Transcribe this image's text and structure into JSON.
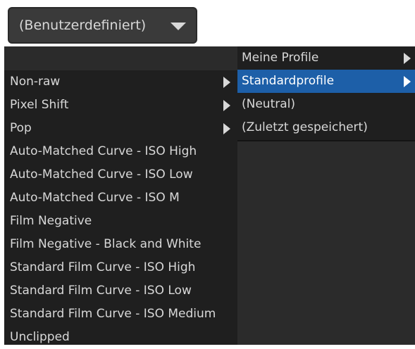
{
  "profile_combo": {
    "value": "(Benutzerdefiniert)"
  },
  "profile_menu": {
    "items": [
      {
        "label": "Meine Profile",
        "has_submenu": true,
        "selected": false
      },
      {
        "label": "Standardprofile",
        "has_submenu": true,
        "selected": true
      },
      {
        "label": "(Neutral)",
        "has_submenu": false,
        "selected": false
      },
      {
        "label": "(Zuletzt gespeichert)",
        "has_submenu": false,
        "selected": false
      }
    ]
  },
  "standard_profiles_menu": {
    "items": [
      {
        "label": "Non-raw",
        "has_submenu": true
      },
      {
        "label": "Pixel Shift",
        "has_submenu": true
      },
      {
        "label": "Pop",
        "has_submenu": true
      },
      {
        "label": "Auto-Matched Curve - ISO High",
        "has_submenu": false
      },
      {
        "label": "Auto-Matched Curve - ISO Low",
        "has_submenu": false
      },
      {
        "label": "Auto-Matched Curve - ISO M",
        "has_submenu": false
      },
      {
        "label": "Film Negative",
        "has_submenu": false
      },
      {
        "label": "Film Negative - Black and White",
        "has_submenu": false
      },
      {
        "label": "Standard Film Curve - ISO High",
        "has_submenu": false
      },
      {
        "label": "Standard Film Curve - ISO Low",
        "has_submenu": false
      },
      {
        "label": "Standard Film Curve - ISO Medium",
        "has_submenu": false
      },
      {
        "label": "Unclipped",
        "has_submenu": false
      }
    ]
  },
  "colors": {
    "menu_bg": "#1f1f1f",
    "selection": "#1d5fa8",
    "text": "#d8d8d8",
    "combo_bg": "#3a3a3a"
  },
  "icons": {
    "combo_arrow": "chevron-down-icon",
    "submenu_arrow": "chevron-right-icon"
  }
}
